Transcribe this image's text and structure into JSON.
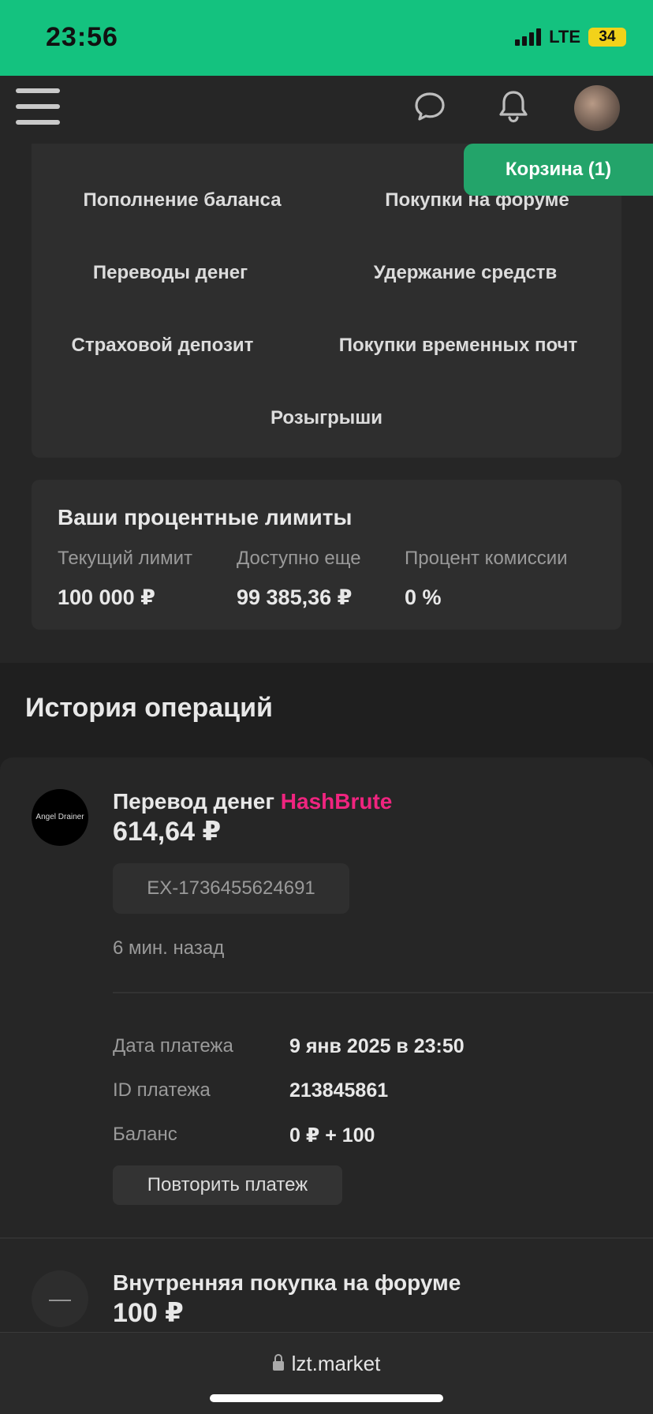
{
  "status_bar": {
    "time": "23:56",
    "network": "LTE",
    "battery": "34"
  },
  "top_nav": {
    "icons": [
      "menu-icon",
      "chat-icon",
      "bell-icon",
      "avatar"
    ]
  },
  "cart": {
    "label": "Корзина (1)"
  },
  "categories": [
    "Пополнение баланса",
    "Покупки на форуме",
    "Переводы денег",
    "Удержание средств",
    "Страховой депозит",
    "Покупки временных почт",
    "Розыгрыши"
  ],
  "limits": {
    "title": "Ваши процентные лимиты",
    "current_label": "Текущий лимит",
    "current_value": "100 000 ₽",
    "available_label": "Доступно еще",
    "available_value": "99 385,36 ₽",
    "fee_label": "Процент комиссии",
    "fee_value": "0 %"
  },
  "history": {
    "title": "История операций",
    "operations": [
      {
        "avatar_text": "Angel Drainer",
        "title": "Перевод денег",
        "user": "HashBrute",
        "amount": "614,64 ₽",
        "comment": "EX-1736455624691",
        "time": "6 мин. назад",
        "date_label": "Дата платежа",
        "date_value": "9 янв 2025 в 23:50",
        "id_label": "ID платежа",
        "id_value": "213845861",
        "balance_label": "Баланс",
        "balance_value": "0 ₽ + 100",
        "repeat_label": "Повторить платеж"
      },
      {
        "title": "Внутренняя покупка на форуме",
        "amount": "100 ₽"
      }
    ]
  },
  "browser": {
    "url": "lzt.market"
  },
  "colors": {
    "accent": "#14c27f",
    "cart": "#23a46a",
    "username": "#f0247f",
    "background": "#1f1f1f"
  }
}
